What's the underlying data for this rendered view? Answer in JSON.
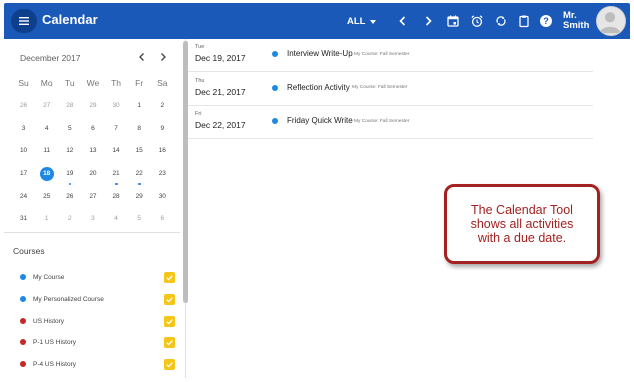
{
  "header": {
    "title": "Calendar",
    "filter_label": "ALL",
    "user_name_line1": "Mr.",
    "user_name_line2": "Smith",
    "icons": [
      "menu-icon",
      "chevron-left-icon",
      "chevron-right-icon",
      "calendar-today-icon",
      "alarm-icon",
      "sync-icon",
      "clipboard-icon",
      "help-icon",
      "avatar"
    ],
    "color": "#1a59b8"
  },
  "mini_calendar": {
    "month_label": "December 2017",
    "weekdays": [
      "Su",
      "Mo",
      "Tu",
      "We",
      "Th",
      "Fr",
      "Sa"
    ],
    "weeks": [
      [
        "26",
        "27",
        "28",
        "29",
        "30",
        "1",
        "2"
      ],
      [
        "3",
        "4",
        "5",
        "6",
        "7",
        "8",
        "9"
      ],
      [
        "10",
        "11",
        "12",
        "13",
        "14",
        "15",
        "16"
      ],
      [
        "17",
        "18",
        "19",
        "20",
        "21",
        "22",
        "23"
      ],
      [
        "24",
        "25",
        "26",
        "27",
        "28",
        "29",
        "30"
      ],
      [
        "31",
        "1",
        "2",
        "3",
        "4",
        "5",
        "6"
      ]
    ],
    "today": "18",
    "event_days": [
      "19",
      "21",
      "22"
    ],
    "accent": "#1e88e5"
  },
  "courses": {
    "title": "Courses",
    "items": [
      {
        "label": "My Course",
        "color": "#1e88e5",
        "checked": true
      },
      {
        "label": "My Personalized Course",
        "color": "#1e88e5",
        "checked": true
      },
      {
        "label": "US History",
        "color": "#c62828",
        "checked": true
      },
      {
        "label": "P-1 US History",
        "color": "#c62828",
        "checked": true
      },
      {
        "label": "P-4 US History",
        "color": "#c62828",
        "checked": true
      }
    ]
  },
  "events": [
    {
      "dow": "Tue",
      "date": "Dec 19, 2017",
      "title": "Interview Write-Up",
      "course": "My Course: Fall Semester"
    },
    {
      "dow": "Thu",
      "date": "Dec 21, 2017",
      "title": "Reflection Activity",
      "course": "My Course: Fall Semester"
    },
    {
      "dow": "Fri",
      "date": "Dec 22, 2017",
      "title": "Friday Quick Write",
      "course": "My Course: Fall Semester"
    }
  ],
  "callout": {
    "text": "The Calendar Tool\nshows all activities\nwith a due date."
  }
}
